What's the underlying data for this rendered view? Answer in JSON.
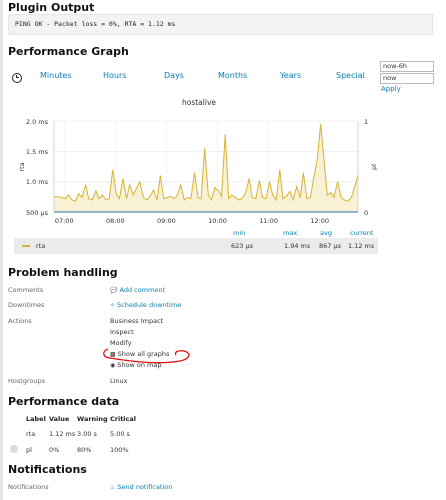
{
  "plugin_output": {
    "heading": "Plugin Output",
    "text": "PING OK - Packet loss = 0%, RTA = 1.12 ms"
  },
  "performance_graph": {
    "heading": "Performance Graph",
    "time_links": [
      "Minutes",
      "Hours",
      "Days",
      "Months",
      "Years",
      "Special"
    ],
    "start_value": "now-6h",
    "end_value": "now",
    "apply_label": "Apply",
    "legend": {
      "series_name": "rta",
      "stat_headers": [
        "min",
        "max",
        "avg",
        "current"
      ],
      "stat_values": [
        "623 µs",
        "1.94 ms",
        "867 µs",
        "1.12 ms"
      ]
    }
  },
  "chart_data": {
    "type": "area",
    "title": "hostalive",
    "ylabel": "rta",
    "y2label": "pl",
    "yticks": [
      "2.0 ms",
      "1.5 ms",
      "1.0 ms",
      "500 µs"
    ],
    "y2ticks": [
      "1",
      "0"
    ],
    "xticks": [
      "07:00",
      "08:00",
      "09:00",
      "10:00",
      "11:00",
      "12:00"
    ],
    "ylim_ms": [
      0.5,
      2.0
    ],
    "x_range_hours": [
      6.8,
      12.75
    ],
    "line_color": "#d4b437",
    "fill_color": "#f8f1d3",
    "series": [
      {
        "name": "rta",
        "unit": "ms",
        "x": [
          6.8,
          6.88,
          6.95,
          7.02,
          7.08,
          7.15,
          7.22,
          7.28,
          7.35,
          7.42,
          7.48,
          7.55,
          7.62,
          7.68,
          7.75,
          7.82,
          7.88,
          7.95,
          8.02,
          8.08,
          8.15,
          8.22,
          8.28,
          8.35,
          8.42,
          8.48,
          8.55,
          8.62,
          8.68,
          8.75,
          8.82,
          8.88,
          8.95,
          9.02,
          9.08,
          9.15,
          9.22,
          9.28,
          9.35,
          9.42,
          9.48,
          9.55,
          9.62,
          9.68,
          9.75,
          9.82,
          9.88,
          9.95,
          10.02,
          10.08,
          10.15,
          10.22,
          10.28,
          10.35,
          10.42,
          10.48,
          10.55,
          10.62,
          10.68,
          10.75,
          10.82,
          10.88,
          10.95,
          11.02,
          11.08,
          11.15,
          11.22,
          11.28,
          11.35,
          11.42,
          11.48,
          11.55,
          11.62,
          11.68,
          11.75,
          11.82,
          11.88,
          11.95,
          12.02,
          12.08,
          12.15,
          12.22,
          12.28,
          12.35,
          12.42,
          12.48,
          12.55,
          12.62,
          12.68,
          12.75
        ],
        "values": [
          0.75,
          0.75,
          0.74,
          0.72,
          0.78,
          0.7,
          0.68,
          0.8,
          0.74,
          0.95,
          0.72,
          0.7,
          0.85,
          0.72,
          0.78,
          0.7,
          0.72,
          1.2,
          0.8,
          0.72,
          1.05,
          0.72,
          0.95,
          0.78,
          0.9,
          1.0,
          0.74,
          0.7,
          0.76,
          0.86,
          0.7,
          1.1,
          0.72,
          0.74,
          0.76,
          0.72,
          0.78,
          0.95,
          0.7,
          0.74,
          0.72,
          1.15,
          0.74,
          0.72,
          1.55,
          0.78,
          0.7,
          0.9,
          0.85,
          0.76,
          1.78,
          0.72,
          0.78,
          0.74,
          0.7,
          0.72,
          0.82,
          1.05,
          0.74,
          0.72,
          1.02,
          0.74,
          0.72,
          1.0,
          0.78,
          0.7,
          1.2,
          0.72,
          0.76,
          0.84,
          0.7,
          0.92,
          0.74,
          1.15,
          0.72,
          0.74,
          1.05,
          1.35,
          1.95,
          1.4,
          0.78,
          0.82,
          0.74,
          1.0,
          0.74,
          0.7,
          0.68,
          0.74,
          0.9,
          1.1
        ]
      }
    ]
  },
  "problem_handling": {
    "heading": "Problem handling",
    "comments_label": "Comments",
    "add_comment": "Add comment",
    "downtimes_label": "Downtimes",
    "schedule_downtime": "Schedule downtime",
    "actions_label": "Actions",
    "actions": [
      "Business Impact",
      "Inspect",
      "Modify"
    ],
    "show_all_graphs": "Show all graphs",
    "show_on_map": "Show on map",
    "hostgroups_label": "Hostgroups",
    "hostgroups_value": "Linux"
  },
  "performance_data": {
    "heading": "Performance data",
    "headers": [
      "Label",
      "Value",
      "Warning",
      "Critical"
    ],
    "rows": [
      [
        "rta",
        "1.12 ms",
        "3.00 s",
        "5.00 s"
      ],
      [
        "pl",
        "0%",
        "80%",
        "100%"
      ]
    ]
  },
  "notifications": {
    "heading": "Notifications",
    "label": "Notifications",
    "send_notification": "Send notification"
  },
  "annotation_color": "#e01010"
}
